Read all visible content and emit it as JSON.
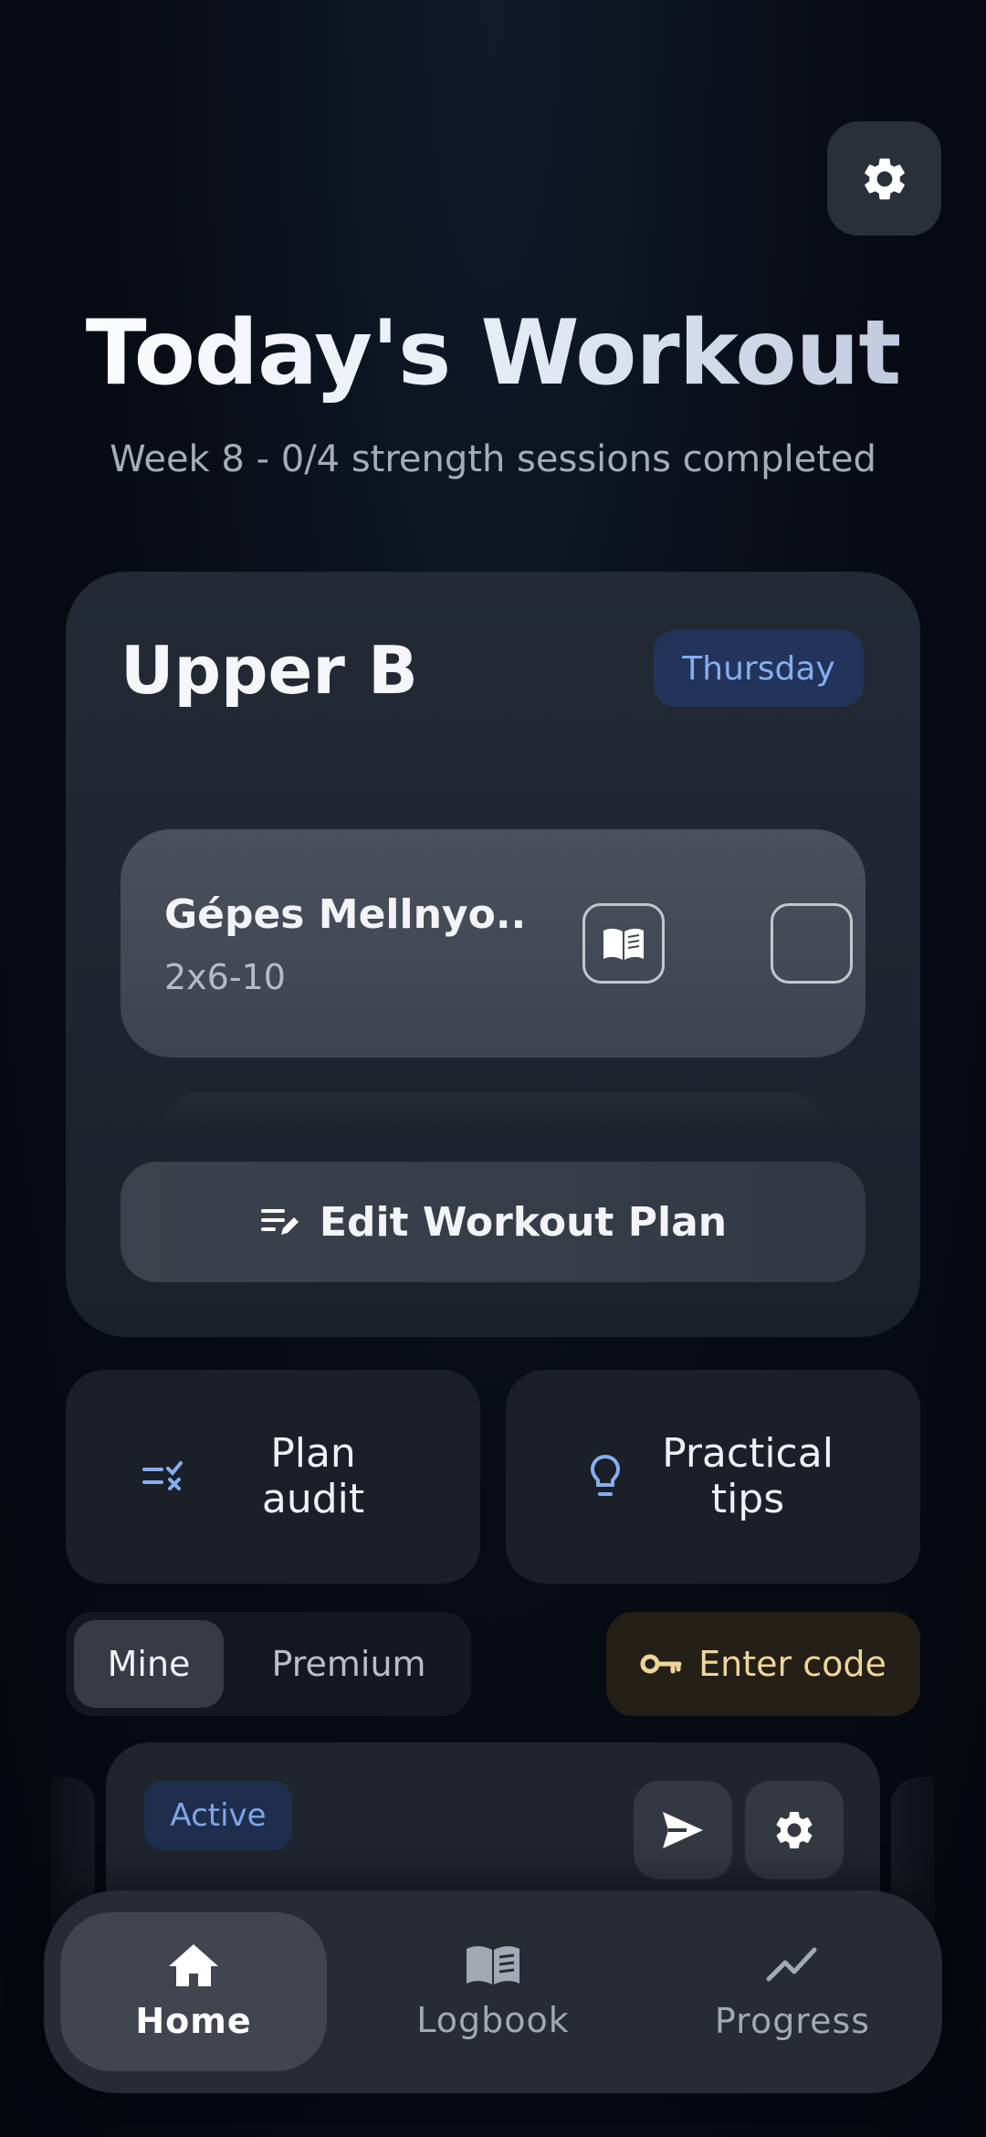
{
  "header": {
    "title": "Today's Workout",
    "subtitle": "Week 8 - 0/4 strength sessions completed",
    "settings_icon": "gear-icon"
  },
  "workout_card": {
    "title": "Upper B",
    "day_badge": "Thursday",
    "exercise": {
      "name": "Gépes Mellnyo...",
      "sets": "2x6-10",
      "book_icon": "book-icon",
      "checked": false
    },
    "edit_button_label": "Edit Workout Plan"
  },
  "tiles": {
    "plan_audit": "Plan audit",
    "practical_tips": "Practical tips"
  },
  "plan_tabs": {
    "mine": "Mine",
    "premium": "Premium",
    "selected": "Mine"
  },
  "enter_code_label": "Enter code",
  "plan_card": {
    "status_badge": "Active"
  },
  "bottom_nav": {
    "items": [
      {
        "label": "Home",
        "icon": "home-icon",
        "active": true
      },
      {
        "label": "Logbook",
        "icon": "book-icon",
        "active": false
      },
      {
        "label": "Progress",
        "icon": "trending-up-icon",
        "active": false
      }
    ]
  },
  "colors": {
    "accent_blue": "#86aef0",
    "accent_gold": "#efd59a",
    "background": "#070b14"
  }
}
